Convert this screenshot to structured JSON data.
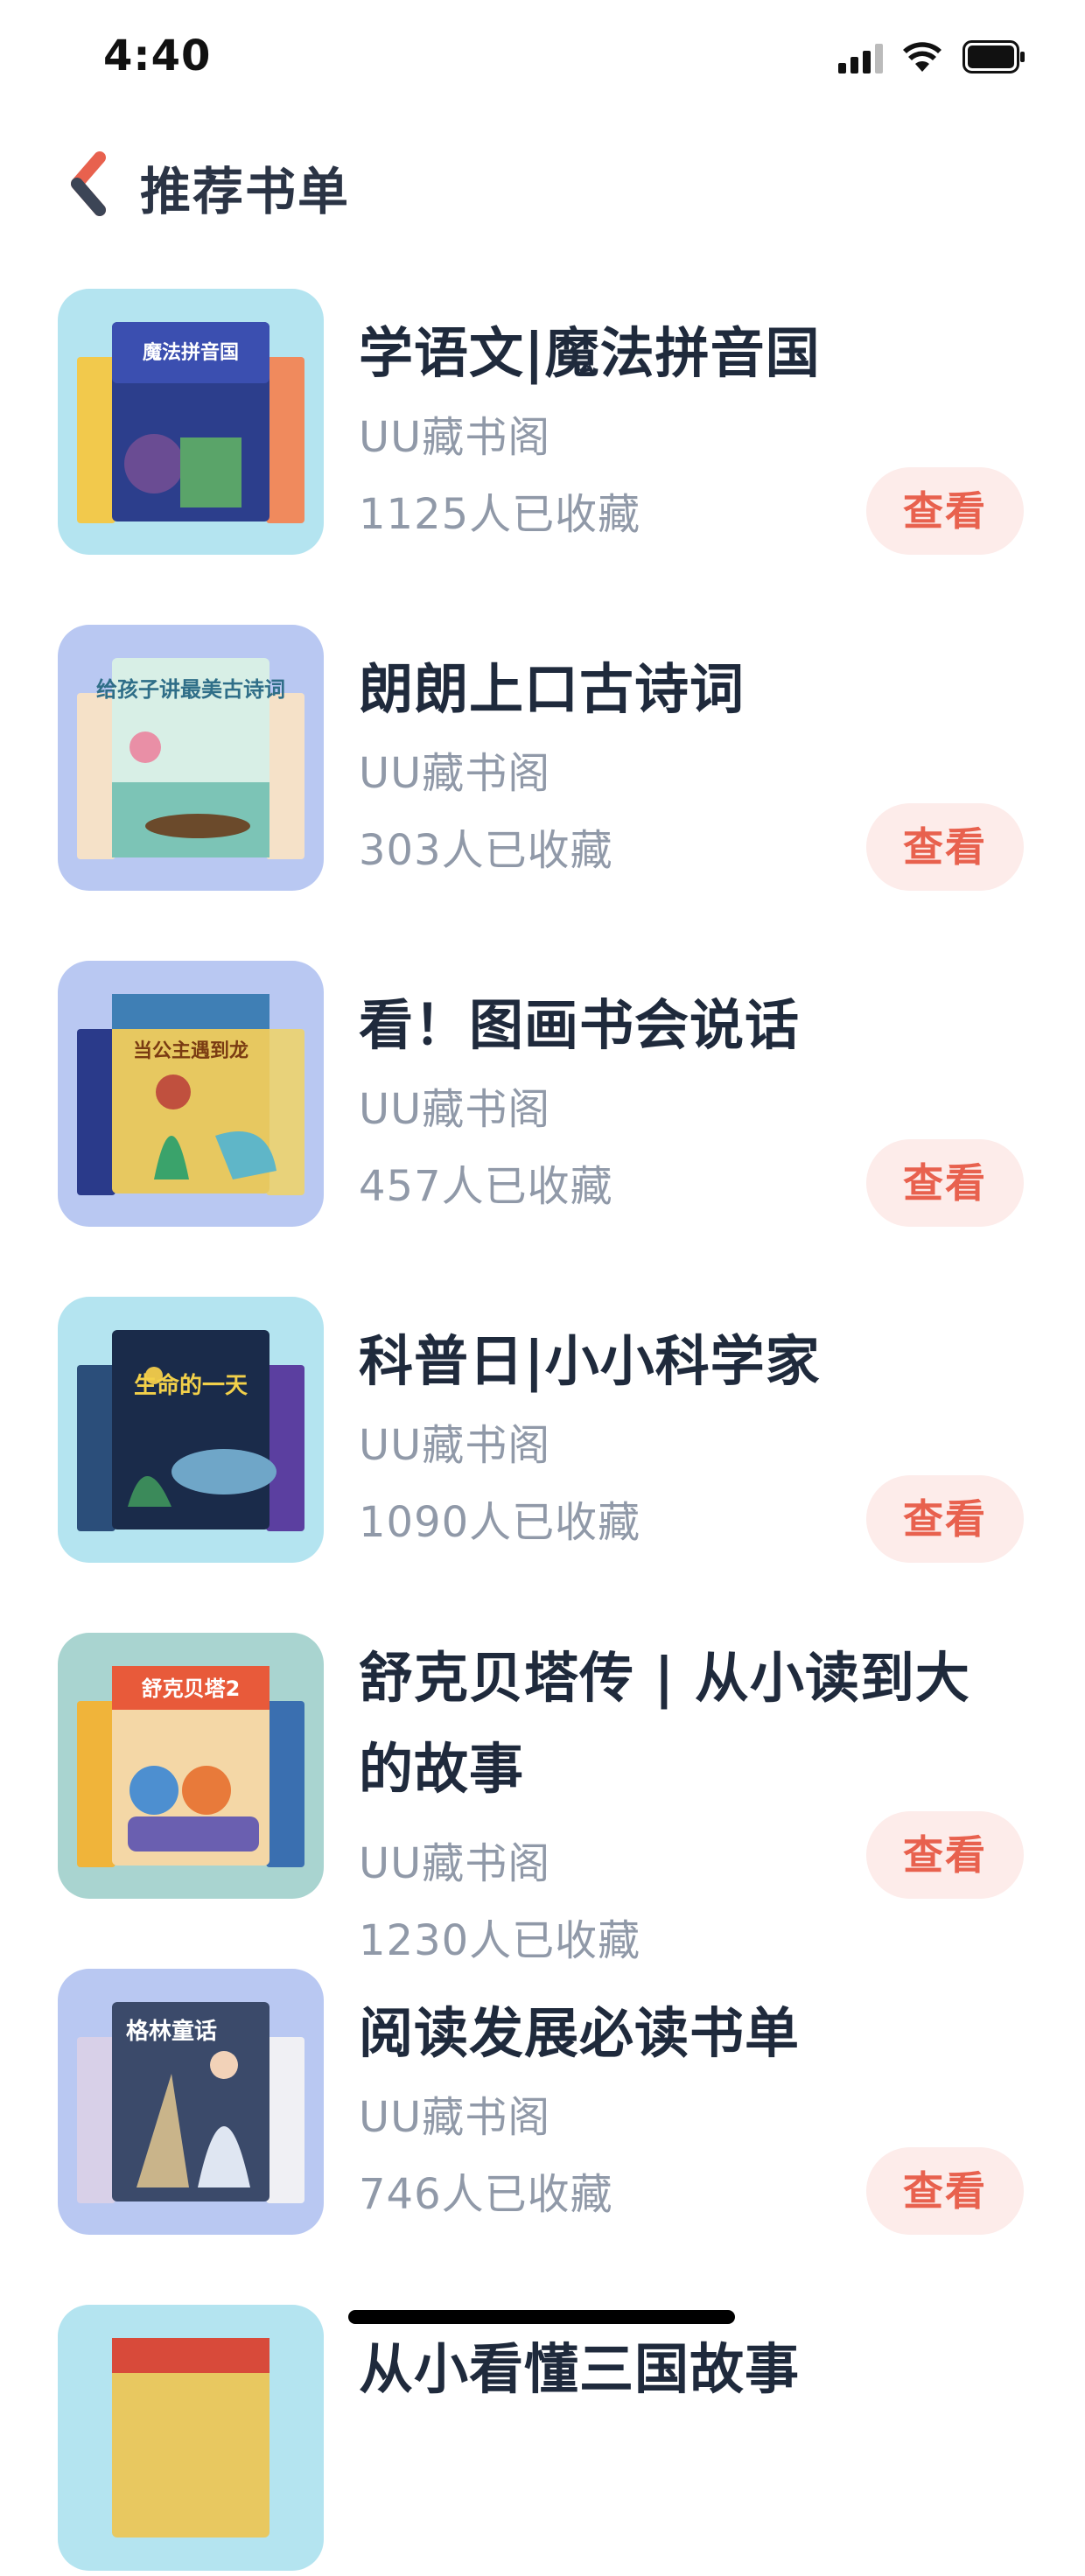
{
  "status_bar": {
    "time": "4:40"
  },
  "header": {
    "title": "推荐书单"
  },
  "books": [
    {
      "title": "学语文|魔法拼音国",
      "source": "UU藏书阁",
      "count": "1125人已收藏",
      "button": "查看",
      "cover_bg": "#b4e4f0",
      "cover_tag": "魔法拼音国"
    },
    {
      "title": "朗朗上口古诗词",
      "source": "UU藏书阁",
      "count": "303人已收藏",
      "button": "查看",
      "cover_bg": "#b9c8f2",
      "cover_tag": "给孩子讲最美古诗词"
    },
    {
      "title": "看！图画书会说话",
      "source": "UU藏书阁",
      "count": "457人已收藏",
      "button": "查看",
      "cover_bg": "#b9c8f2",
      "cover_tag": "当公主遇到龙"
    },
    {
      "title": "科普日|小小科学家",
      "source": "UU藏书阁",
      "count": "1090人已收藏",
      "button": "查看",
      "cover_bg": "#b4e4f0",
      "cover_tag": "生命的一天"
    },
    {
      "title": "舒克贝塔传 | 从小读到大的故事",
      "source": "UU藏书阁",
      "count": "1230人已收藏",
      "button": "查看",
      "cover_bg": "#a9d4d0",
      "cover_tag": "舒克贝塔2"
    },
    {
      "title": "阅读发展必读书单",
      "source": "UU藏书阁",
      "count": "746人已收藏",
      "button": "查看",
      "cover_bg": "#b9c8f2",
      "cover_tag": "格林童话"
    },
    {
      "title": "从小看懂三国故事",
      "source": "",
      "count": "",
      "button": "",
      "cover_bg": "#b4e4f0",
      "cover_tag": ""
    }
  ]
}
